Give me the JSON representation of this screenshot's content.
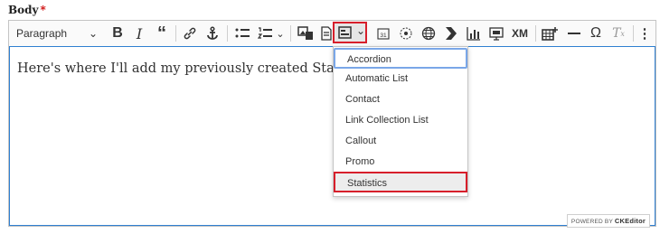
{
  "field": {
    "label": "Body",
    "required_mark": "*"
  },
  "toolbar": {
    "heading_select": {
      "value": "Paragraph"
    },
    "xml_label": "XM",
    "omega_label": "Ω",
    "tx_label": "T",
    "calendar_label": "31"
  },
  "editor": {
    "content": "Here's where I'll add my previously created Statistics."
  },
  "dropdown": {
    "items": [
      {
        "label": "Accordion"
      },
      {
        "label": "Automatic List"
      },
      {
        "label": "Contact"
      },
      {
        "label": "Link Collection List"
      },
      {
        "label": "Callout"
      },
      {
        "label": "Promo"
      },
      {
        "label": "Statistics"
      }
    ]
  },
  "footer": {
    "powered_prefix": "POWERED BY",
    "powered_brand": "CKEditor"
  }
}
